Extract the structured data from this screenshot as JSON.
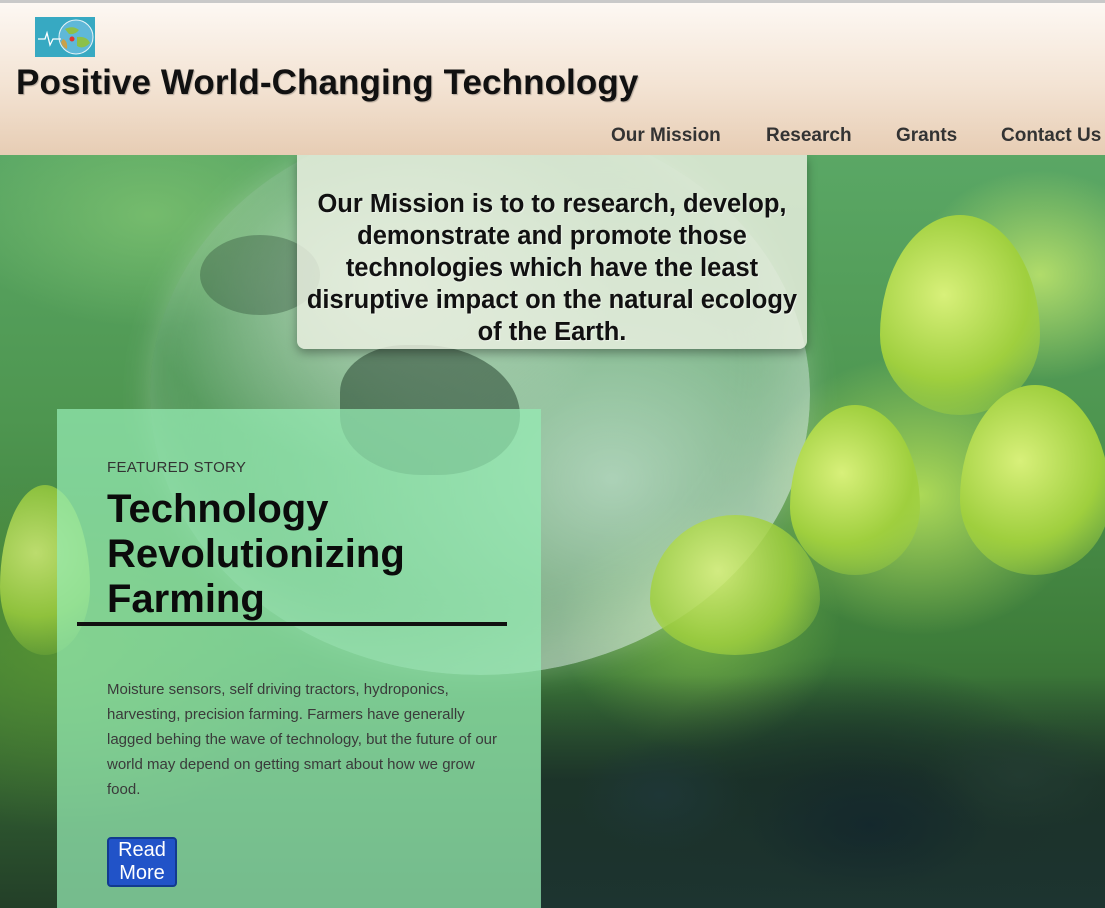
{
  "header": {
    "title": "Positive World-Changing Technology",
    "logo_icon": "globe-logo-icon"
  },
  "nav": {
    "items": [
      {
        "label": "Our Mission"
      },
      {
        "label": "Research"
      },
      {
        "label": "Grants"
      },
      {
        "label": "Contact Us"
      }
    ]
  },
  "mission": {
    "text": "Our Mission is to to research, develop, demonstrate and promote those technologies which have the least disruptive impact on the natural ecology of the Earth."
  },
  "featured": {
    "label": "FEATURED STORY",
    "title": "Technology Revolutionizing Farming",
    "body": "Moisture sensors, self driving tractors, hydroponics, harvesting, precision farming. Farmers have generally lagged behing the wave of technology, but the future of our world may depend on getting smart about how we grow food.",
    "button_label": "Read More"
  },
  "colors": {
    "header_bg": "#f3e3d3",
    "button_bg": "#2153c8",
    "featured_bg": "#96ebb4"
  }
}
